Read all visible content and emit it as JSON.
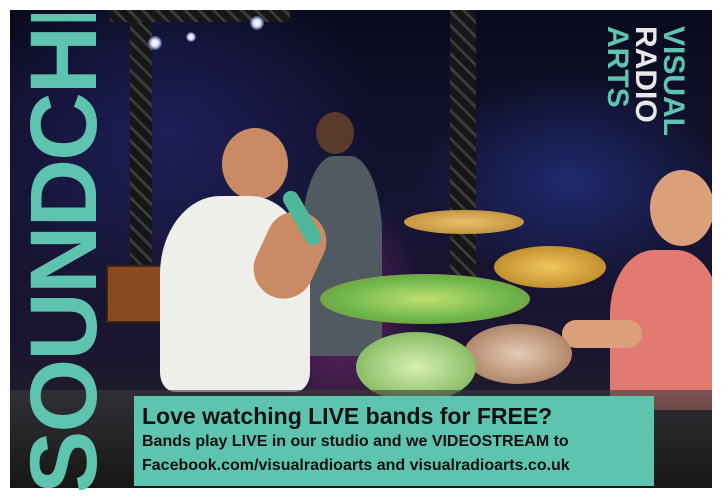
{
  "side_title": "SOUNDCHECK",
  "logo": {
    "line1": "VISUAL",
    "line2": "RADIO",
    "line3": "ARTS"
  },
  "banner": {
    "headline": "Love watching LIVE bands for FREE?",
    "line1": "Bands play LIVE in our studio and we VIDEOSTREAM to",
    "line2": "Facebook.com/visualradioarts and visualradioarts.co.uk"
  },
  "colors": {
    "accent": "#5ec4b0",
    "text_dark": "#111111",
    "background": "#ffffff"
  }
}
